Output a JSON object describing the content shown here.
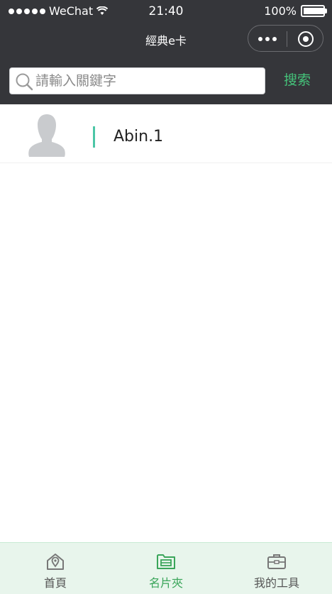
{
  "status_bar": {
    "carrier": "WeChat",
    "time": "21:40",
    "battery": "100%",
    "battery_level": 1.0
  },
  "nav": {
    "title": "經典e卡"
  },
  "search": {
    "placeholder": "請輸入關鍵字",
    "value": "",
    "button_label": "搜索"
  },
  "cards": [
    {
      "name": "Abin.1",
      "avatar": "person-silhouette-icon"
    }
  ],
  "tabbar": {
    "items": [
      {
        "label": "首頁",
        "icon": "home-location-icon",
        "active": false
      },
      {
        "label": "名片夾",
        "icon": "card-folder-icon",
        "active": true
      },
      {
        "label": "我的工具",
        "icon": "toolbox-icon",
        "active": false
      }
    ]
  },
  "colors": {
    "header_bg": "#35363a",
    "accent_green": "#45c37a",
    "indicator": "#4cc6a6",
    "tabbar_bg": "#e8f5ec"
  }
}
